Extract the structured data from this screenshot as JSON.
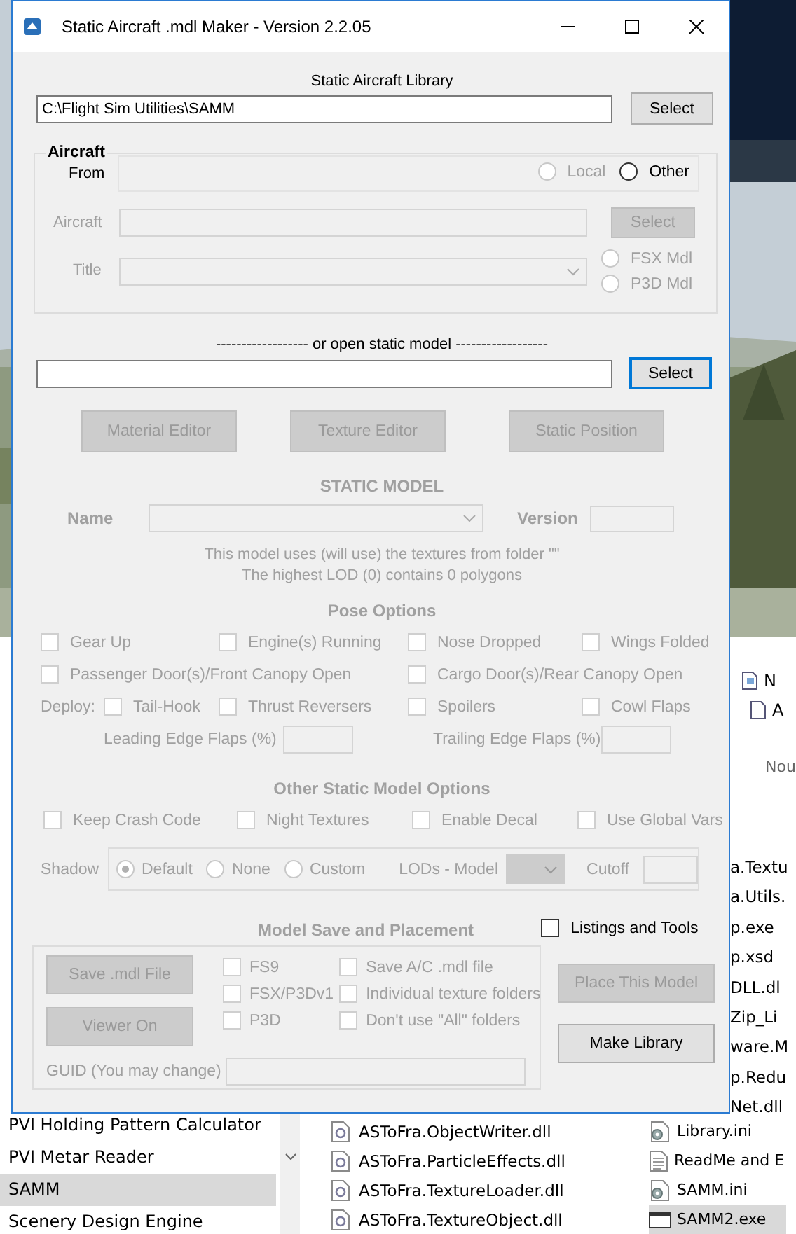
{
  "window": {
    "title": "Static Aircraft .mdl Maker - Version 2.2.05"
  },
  "library": {
    "label": "Static Aircraft Library",
    "path": "C:\\Flight Sim Utilities\\SAMM",
    "button": {
      "label": "Select",
      "disabled": false
    }
  },
  "aircraft_group": {
    "legend": "Aircraft",
    "disabled": true,
    "from": {
      "label": "From",
      "sources": [
        {
          "label": "Local",
          "selected": false,
          "disabled": true
        },
        {
          "label": "Other",
          "selected": false,
          "disabled": false
        }
      ]
    },
    "aircraft": {
      "label": "Aircraft",
      "button": {
        "label": "Select",
        "disabled": true
      }
    },
    "title": {
      "label": "Title",
      "formats": [
        {
          "label": "FSX Mdl",
          "selected": false
        },
        {
          "label": "P3D Mdl",
          "selected": false
        }
      ]
    }
  },
  "open_model": {
    "label": "------------------ or open static model ------------------",
    "button": {
      "label": "Select",
      "focused": true
    }
  },
  "editor_buttons": [
    {
      "label": "Material Editor",
      "disabled": true
    },
    {
      "label": "Texture Editor",
      "disabled": true
    },
    {
      "label": "Static Position",
      "disabled": true
    }
  ],
  "static_model": {
    "heading": "STATIC MODEL",
    "disabled": true,
    "name_label": "Name",
    "version_label": "Version",
    "info": [
      "This model uses (will use) the textures from folder \"\"",
      "The highest LOD (0) contains 0 polygons"
    ]
  },
  "pose_options": {
    "heading": "Pose Options",
    "disabled": true,
    "checks": [
      {
        "label": "Gear Up",
        "checked": false,
        "wide": false
      },
      {
        "label": "Engine(s) Running",
        "checked": false,
        "wide": false
      },
      {
        "label": "Nose Dropped",
        "checked": false,
        "wide": false
      },
      {
        "label": "Wings Folded",
        "checked": false,
        "wide": false
      },
      {
        "label": "Passenger Door(s)/Front Canopy Open",
        "checked": false,
        "wide": true
      },
      {
        "label": "Cargo Door(s)/Rear Canopy Open",
        "checked": false,
        "wide": true
      }
    ],
    "deploy_label": "Deploy:",
    "deploy": [
      {
        "label": "Tail-Hook",
        "checked": false
      },
      {
        "label": "Thrust Reversers",
        "checked": false
      },
      {
        "label": "Spoilers",
        "checked": false
      },
      {
        "label": "Cowl Flaps",
        "checked": false
      }
    ],
    "flaps": [
      {
        "label": "Leading Edge Flaps (%)"
      },
      {
        "label": "Trailing Edge Flaps (%)"
      }
    ]
  },
  "other_options": {
    "heading": "Other Static Model Options",
    "disabled": true,
    "checks": [
      {
        "label": "Keep Crash Code",
        "checked": false
      },
      {
        "label": "Night Textures",
        "checked": false
      },
      {
        "label": "Enable Decal",
        "checked": false
      },
      {
        "label": "Use Global Vars",
        "checked": false
      }
    ],
    "shadow": {
      "label": "Shadow",
      "options": [
        {
          "label": "Default",
          "selected": true
        },
        {
          "label": "None",
          "selected": false
        },
        {
          "label": "Custom",
          "selected": false
        }
      ],
      "lods_label": "LODs - Model",
      "cutoff_label": "Cutoff"
    }
  },
  "save": {
    "heading": "Model Save and Placement",
    "disabled": true,
    "listings": {
      "label": "Listings and Tools",
      "checked": false
    },
    "buttons": [
      {
        "label": "Save .mdl File",
        "disabled": true
      },
      {
        "label": "Viewer On",
        "disabled": true
      }
    ],
    "targets": [
      {
        "label": "FS9",
        "checked": false
      },
      {
        "label": "FSX/P3Dv1",
        "checked": false
      },
      {
        "label": "P3D",
        "checked": false
      }
    ],
    "options": [
      {
        "label": "Save A/C .mdl file",
        "checked": false
      },
      {
        "label": "Individual texture folders",
        "checked": false
      },
      {
        "label": "Don't use \"All\" folders",
        "checked": false
      }
    ],
    "guid_label": "GUID (You may change)",
    "actions": [
      {
        "label": "Place This Model",
        "disabled": true
      },
      {
        "label": "Make Library",
        "disabled": false
      }
    ]
  },
  "explorer": {
    "ribbon": [
      {
        "label": "N"
      },
      {
        "label": "A"
      }
    ],
    "ribbon_group": "Nou",
    "cut_files": [
      "a.Textu",
      "a.Utils.",
      "p.exe",
      "p.xsd",
      "DLL.dl",
      "Zip_Li",
      "ware.M",
      "p.Redu",
      "Net.dll"
    ],
    "nav_items": [
      {
        "label": "PVI Holding Pattern Calculator",
        "selected": false
      },
      {
        "label": "PVI Metar Reader",
        "selected": false
      },
      {
        "label": "SAMM",
        "selected": true
      },
      {
        "label": "Scenery Design Engine",
        "selected": false
      }
    ],
    "files": [
      {
        "name": "ASToFra.ObjectWriter.dll",
        "kind": "library",
        "selected": false
      },
      {
        "name": "ASToFra.ParticleEffects.dll",
        "kind": "library",
        "selected": false
      },
      {
        "name": "ASToFra.TextureLoader.dll",
        "kind": "library",
        "selected": false
      },
      {
        "name": "ASToFra.TextureObject.dll",
        "kind": "library",
        "selected": false
      },
      {
        "name": "Library.ini",
        "kind": "settings",
        "selected": false
      },
      {
        "name": "ReadMe and E",
        "kind": "text",
        "selected": false
      },
      {
        "name": "SAMM.ini",
        "kind": "settings",
        "selected": false
      },
      {
        "name": "SAMM2.exe",
        "kind": "program",
        "selected": true
      }
    ]
  }
}
